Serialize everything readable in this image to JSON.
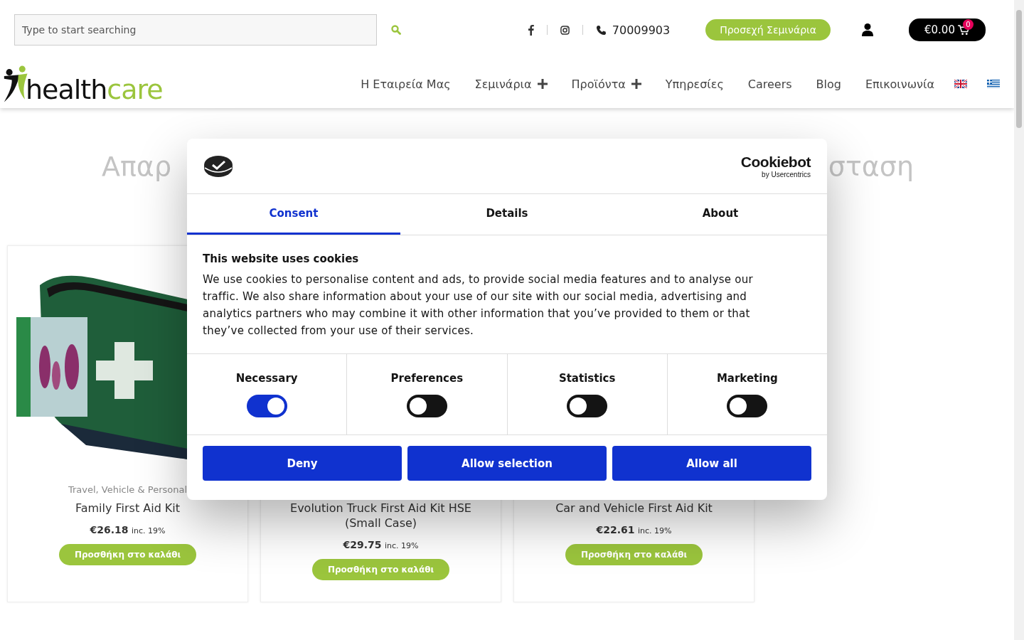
{
  "header": {
    "search": {
      "placeholder": "Type to start searching"
    },
    "phone": "70009903",
    "seminars_button": "Προσεχή Σεμινάρια",
    "cart": {
      "total": "€0.00",
      "count": "0"
    }
  },
  "logo": {
    "part_1": "health",
    "part_2": "care"
  },
  "nav": [
    {
      "label": "Η Εταιρεία Μας",
      "has_submenu": false
    },
    {
      "label": "Σεμινάρια",
      "has_submenu": true
    },
    {
      "label": "Προϊόντα",
      "has_submenu": true
    },
    {
      "label": "Υπηρεσίες",
      "has_submenu": false
    },
    {
      "label": "Careers",
      "has_submenu": false
    },
    {
      "label": "Blog",
      "has_submenu": false
    },
    {
      "label": "Επικοινωνία",
      "has_submenu": false
    }
  ],
  "page_heading": {
    "left_part": "Απαρ",
    "right_part": "σταση"
  },
  "products": [
    {
      "kind": "picture",
      "category": "Travel, Vehicle & Personal",
      "name": "Family First Aid Kit",
      "price": "€26.18",
      "tax": "inc. 19%",
      "button": "Προσθήκη στο καλάθι"
    },
    {
      "kind": "plain",
      "name": "Evolution Truck First Aid Kit HSE (Small Case)",
      "price": "€29.75",
      "tax": "inc. 19%",
      "button": "Προσθήκη στο καλάθι"
    },
    {
      "kind": "plain",
      "name": "Car and Vehicle First Aid Kit",
      "price": "€22.61",
      "tax": "inc. 19%",
      "button": "Προσθήκη στο καλάθι"
    }
  ],
  "cookie_dialog": {
    "brand": "Cookiebot",
    "brand_sub": "by Usercentrics",
    "tabs": [
      {
        "label": "Consent",
        "selected": true
      },
      {
        "label": "Details",
        "selected": false
      },
      {
        "label": "About",
        "selected": false
      }
    ],
    "title": "This website uses cookies",
    "text": "We use cookies to personalise content and ads, to provide social media features and to analyse our traffic. We also share information about your use of our site with our social media, advertising and analytics partners who may combine it with other information that you’ve provided to them or that they’ve collected from your use of their services.",
    "categories": [
      {
        "label": "Necessary",
        "on": true
      },
      {
        "label": "Preferences",
        "on": false
      },
      {
        "label": "Statistics",
        "on": false
      },
      {
        "label": "Marketing",
        "on": false
      }
    ],
    "buttons": [
      "Deny",
      "Allow selection",
      "Allow all"
    ]
  }
}
